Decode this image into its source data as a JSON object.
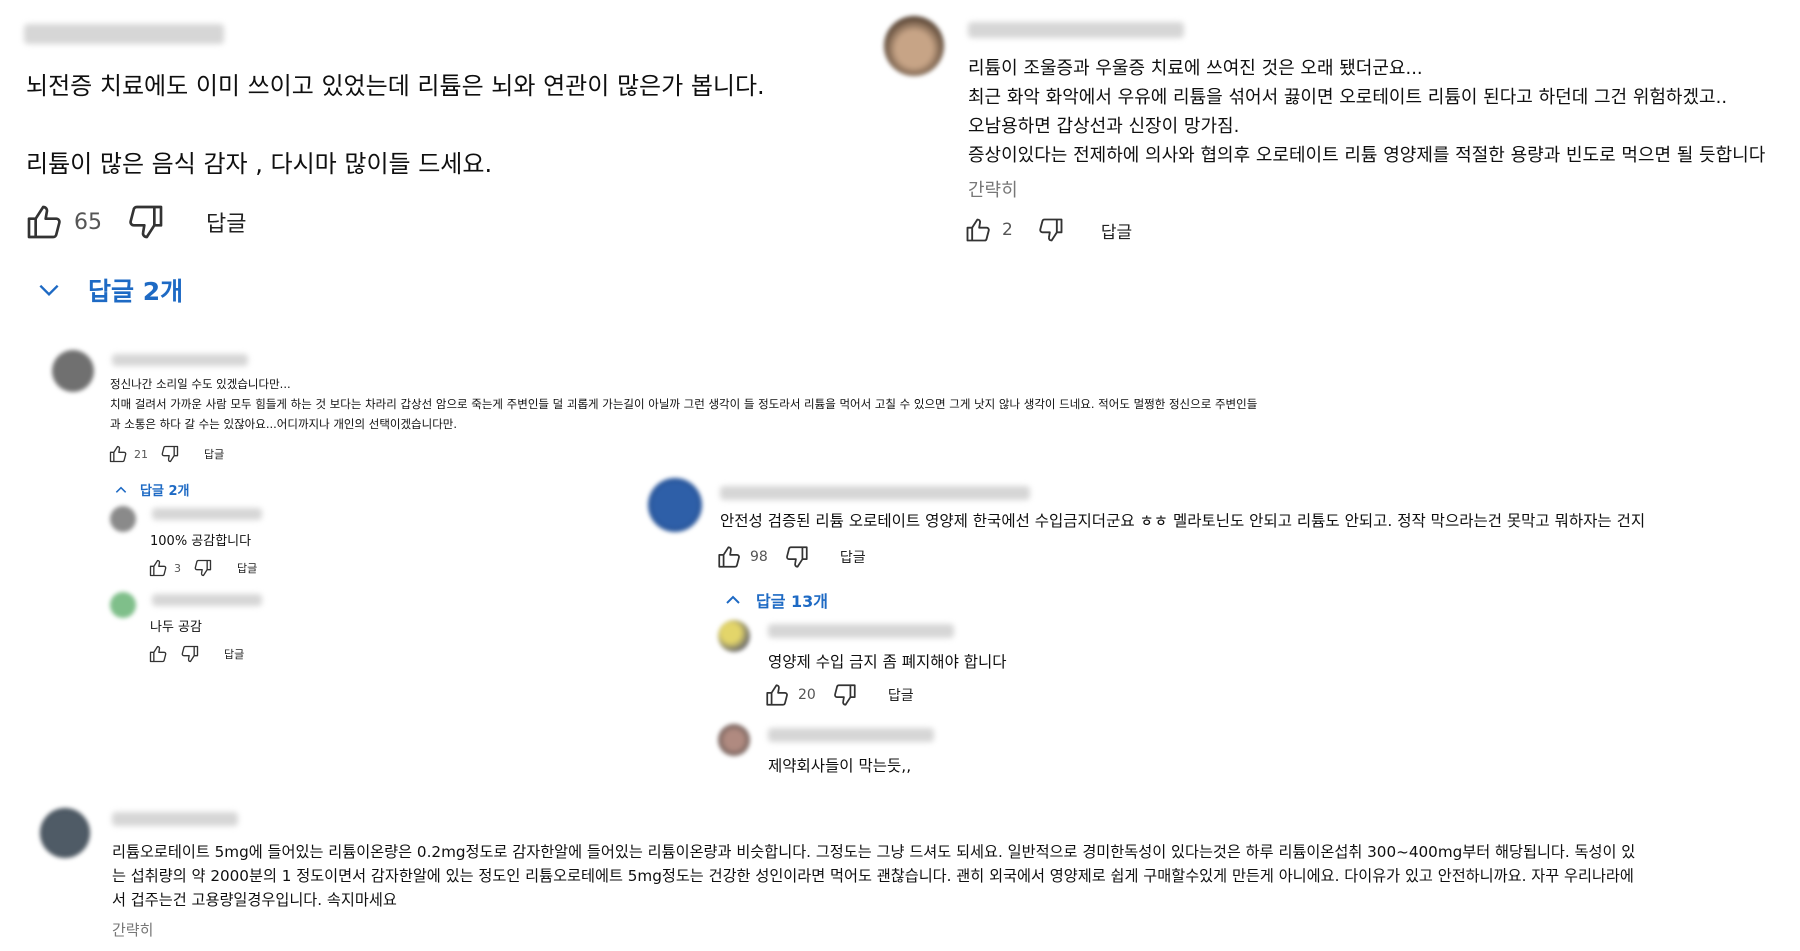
{
  "colors": {
    "link_blue": "#1e6ac4",
    "text": "#0f0f0f",
    "muted": "#777777"
  },
  "top_left": {
    "line1": "뇌전증 치료에도 이미 쓰이고 있었는데 리튬은 뇌와 연관이 많은가 봅니다.",
    "line2": "리튬이 많은 음식 감자 , 다시마 많이들 드세요.",
    "likes": "65",
    "reply_label": "답글",
    "replies_toggle": "답글 2개"
  },
  "top_right": {
    "lines": [
      "리튬이 조울증과 우울증 치료에 쓰여진 것은 오래 됐더군요...",
      "최근 화악 화악에서 우유에 리튬을 섞어서 끓이면 오로테이트 리튬이 된다고 하던데 그건 위험하겠고..",
      "오남용하면 갑상선과 신장이 망가짐.",
      "증상이있다는 전제하에 의사와 협의후 오로테이트 리튬 영양제를 적절한 용량과 빈도로 먹으면 될 듯합니다"
    ],
    "shrink": "간략히",
    "likes": "2",
    "reply_label": "답글"
  },
  "mid_left": {
    "lines": [
      "정신나간 소리일 수도 있겠습니다만...",
      "치매 걸려서 가까운 사람 모두 힘들게 하는 것 보다는 차라리 갑상선 암으로 죽는게 주변인들 덜 괴롭게 가는길이 아닐까 그런 생각이 들 정도라서 리튬을 먹어서 고칠 수 있으면 그게 낫지 않나 생각이 드네요. 적어도 멀쩡한 정신으로 주변인들",
      "과 소통은 하다 갈 수는 있잖아요...어디까지나 개인의 선택이겠습니다만."
    ],
    "likes": "21",
    "reply_label": "답글",
    "replies_toggle": "답글 2개",
    "replies": [
      {
        "text": "100% 공감합니다",
        "likes": "3",
        "reply_label": "답글"
      },
      {
        "text": "나두 공감",
        "likes": "",
        "reply_label": "답글"
      }
    ]
  },
  "mid_right": {
    "text": "안전성 검증된 리튬 오로테이트 영양제 한국에선 수입금지더군요 ㅎㅎ 멜라토닌도 안되고 리튬도 안되고. 정작 막으라는건 못막고 뭐하자는 건지",
    "likes": "98",
    "reply_label": "답글",
    "replies_toggle": "답글 13개",
    "replies": [
      {
        "text": "영양제 수입 금지 좀 폐지해야 합니다",
        "likes": "20",
        "reply_label": "답글"
      },
      {
        "text": "제약회사들이 막는듯,,"
      }
    ]
  },
  "bottom": {
    "lines": [
      "리튬오로테이트 5mg에 들어있는 리튬이온량은 0.2mg정도로 감자한알에 들어있는 리튬이온량과 비슷합니다. 그정도는 그냥 드셔도 되세요. 일반적으로 경미한독성이 있다는것은 하루 리튬이온섭취 300~400mg부터 해당됩니다. 독성이 있",
      "는 섭취량의 약 2000분의 1 정도이면서 감자한알에 있는 정도인 리튬오로테에트 5mg정도는 건강한 성인이라면 먹어도 괜찮습니다. 괜히 외국에서 영양제로 쉽게 구매할수있게 만든게 아니에요. 다이유가 있고 안전하니까요. 자꾸 우리나라에",
      "서 겁주는건 고용량일경우입니다. 속지마세요"
    ],
    "shrink": "간략히"
  },
  "icons": [
    "thumbs-up-icon",
    "thumbs-down-icon",
    "chevron-down-icon",
    "chevron-up-icon"
  ]
}
